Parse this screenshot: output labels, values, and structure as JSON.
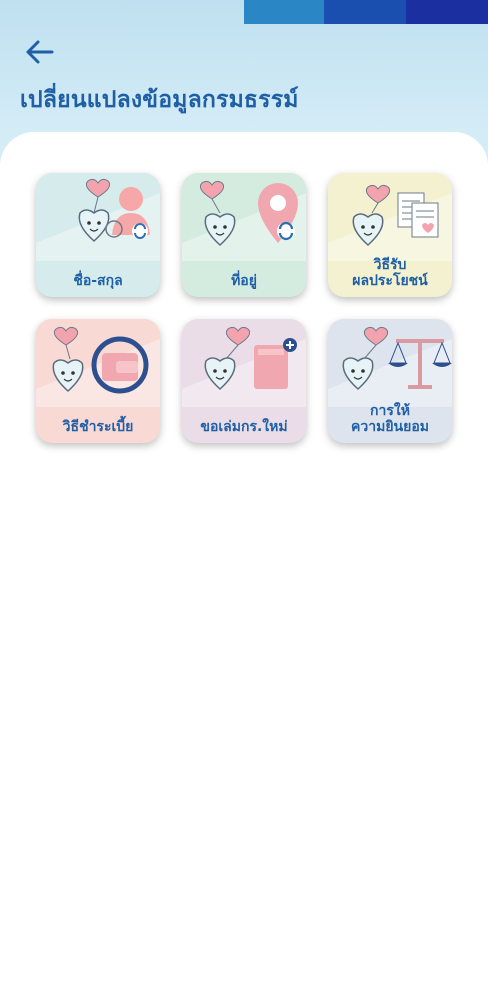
{
  "header": {
    "title": "เปลี่ยนแปลงข้อมูลกรมธรรม์",
    "back_icon": "arrow-left-icon",
    "stripe_colors": [
      "#2b86c5",
      "#1a4fb0",
      "#1c2fa0"
    ]
  },
  "colors": {
    "accent": "#1f5fa6",
    "header_bg": "#c6e4f2"
  },
  "menu": {
    "items": [
      {
        "id": "name",
        "label_lines": [
          "ชื่อ-สกุล"
        ],
        "icon": "person-sync-icon",
        "bg": "#d6ecec"
      },
      {
        "id": "address",
        "label_lines": [
          "ที่อยู่"
        ],
        "icon": "location-pin-sync-icon",
        "bg": "#d4ecdf"
      },
      {
        "id": "benefit",
        "label_lines": [
          "วิธีรับ",
          "ผลประโยชน์"
        ],
        "icon": "document-transfer-icon",
        "bg": "#f3f1cf"
      },
      {
        "id": "premium",
        "label_lines": [
          "วิธีชำระเบี้ย"
        ],
        "icon": "wallet-sync-icon",
        "bg": "#f8d9d4"
      },
      {
        "id": "new_policy_book",
        "label_lines": [
          "ขอเล่มกร.ใหม่"
        ],
        "icon": "book-add-icon",
        "bg": "#ebdde8"
      },
      {
        "id": "consent",
        "label_lines": [
          "การให้",
          "ความยินยอม"
        ],
        "icon": "scale-icon",
        "bg": "#dde4ee"
      }
    ]
  }
}
